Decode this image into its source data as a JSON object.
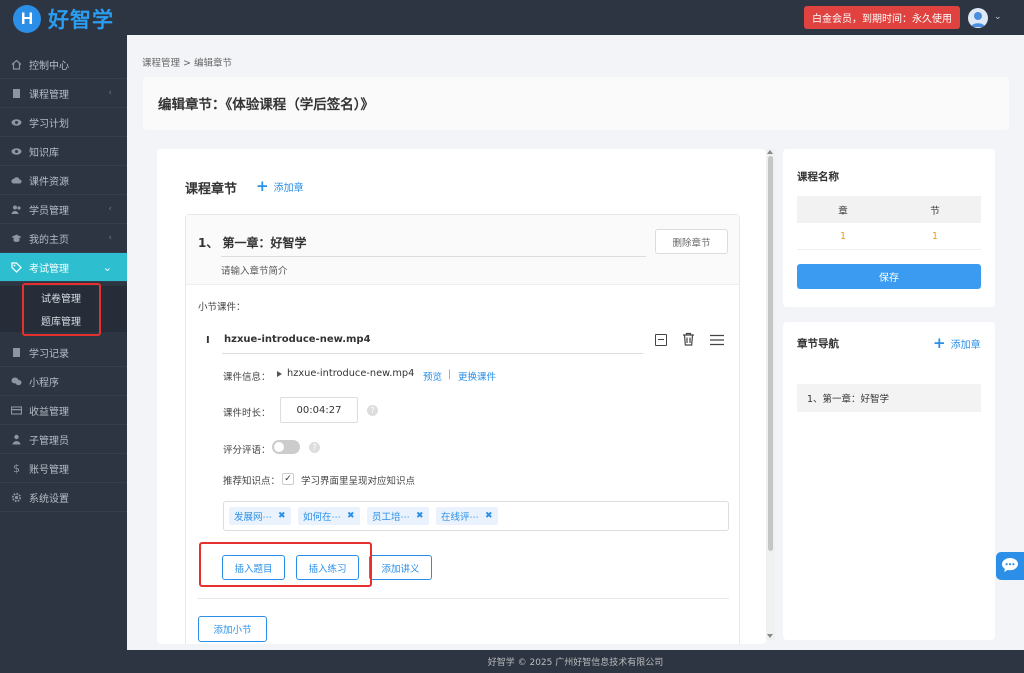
{
  "app": {
    "logo_letter": "H",
    "logo_text": "好智学"
  },
  "header": {
    "member_badge": "白金会员，到期时间：永久使用",
    "caret": "⌄"
  },
  "sidebar": {
    "items": [
      {
        "label": "控制中心",
        "icon": "home-icon",
        "arrow": ""
      },
      {
        "label": "课程管理",
        "icon": "book-icon",
        "arrow": "‹"
      },
      {
        "label": "学习计划",
        "icon": "eye-icon",
        "arrow": ""
      },
      {
        "label": "知识库",
        "icon": "eye-icon",
        "arrow": ""
      },
      {
        "label": "课件资源",
        "icon": "cloud-icon",
        "arrow": ""
      },
      {
        "label": "学员管理",
        "icon": "users-icon",
        "arrow": "‹"
      },
      {
        "label": "我的主页",
        "icon": "graduation-cap-icon",
        "arrow": "‹"
      },
      {
        "label": "考试管理",
        "icon": "tag-icon",
        "arrow": "⌄"
      },
      {
        "label": "学习记录",
        "icon": "book-icon",
        "arrow": ""
      },
      {
        "label": "小程序",
        "icon": "chat-icon",
        "arrow": ""
      },
      {
        "label": "收益管理",
        "icon": "card-icon",
        "arrow": ""
      },
      {
        "label": "子管理员",
        "icon": "user-icon",
        "arrow": ""
      },
      {
        "label": "账号管理",
        "icon": "dollar-icon",
        "arrow": ""
      },
      {
        "label": "系统设置",
        "icon": "gear-icon",
        "arrow": ""
      }
    ],
    "subitems": [
      "试卷管理",
      "题库管理"
    ]
  },
  "breadcrumb": "课程管理 > 编辑章节",
  "page_title": "编辑章节：《体验课程（学后签名）》",
  "main": {
    "section_title": "课程章节",
    "add_chapter": "添加章",
    "chapter": {
      "title": "1、 第一章：好智学",
      "intro": "请输入章节简介",
      "delete_label": "删除章节",
      "section_courseware_label": "小节课件：",
      "lesson": {
        "marker": "I",
        "filename": "hzxue-introduce-new.mp4",
        "info_label": "课件信息：",
        "info_file": "hzxue-introduce-new.mp4",
        "preview": "预览",
        "separator": "|",
        "replace": "更换课件",
        "duration_label": "课件时长：",
        "duration": "00:04:27",
        "rating_label": "评分评语：",
        "recommend_label": "推荐知识点：",
        "recommend_check": "学习界面里呈现对应知识点",
        "tags": [
          "发展网⋯",
          "如何在⋯",
          "员工培⋯",
          "在线评⋯"
        ],
        "insert_question": "插入题目",
        "insert_practice": "插入练习",
        "add_handout": "添加讲义"
      },
      "add_section": "添加小节"
    }
  },
  "course_panel": {
    "title": "课程名称",
    "headers": [
      "章",
      "节"
    ],
    "values": [
      "1",
      "1"
    ],
    "save": "保存"
  },
  "nav_panel": {
    "title": "章节导航",
    "add": "添加章",
    "items": [
      "1、第一章：好智学"
    ]
  },
  "footer": "好智学 © 2025 广州好智信息技术有限公司",
  "colors": {
    "accent": "#2b8fe8",
    "sidebar_bg": "#2d3543",
    "active": "#2dbfd0",
    "badge": "#e0423f",
    "highlight_box": "#e5312e"
  }
}
